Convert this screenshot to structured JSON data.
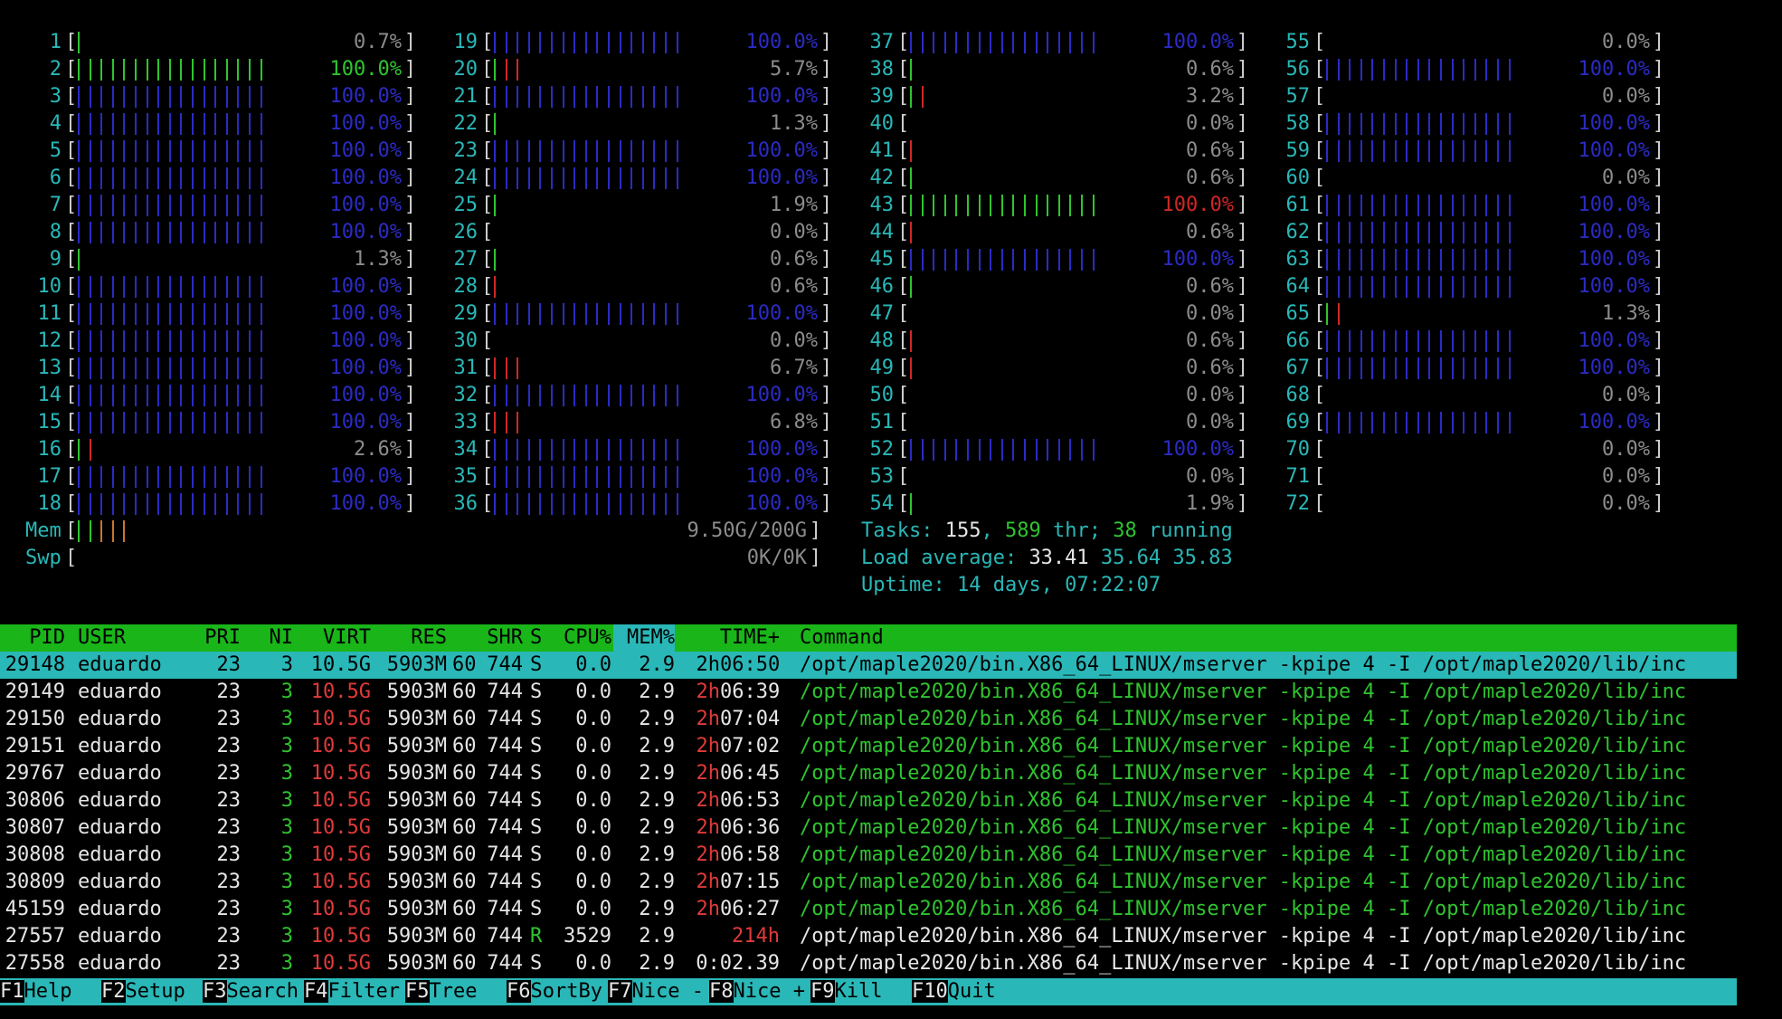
{
  "colors": {
    "background": "#000000",
    "cyan": "#2ab7b7",
    "blue_bar": "#2b2bc4",
    "green_bar": "#2fc42f",
    "red_bar": "#d02727",
    "header_bg": "#19b519"
  },
  "cpu_meters": [
    {
      "id": "1",
      "bars": [
        "g"
      ],
      "pct": "0.7%"
    },
    {
      "id": "2",
      "bars": [
        "g*17"
      ],
      "pct": "100.0%",
      "pct_color": "green"
    },
    {
      "id": "3",
      "bars": [
        "b*17"
      ],
      "pct": "100.0%"
    },
    {
      "id": "4",
      "bars": [
        "b*17"
      ],
      "pct": "100.0%"
    },
    {
      "id": "5",
      "bars": [
        "b*17"
      ],
      "pct": "100.0%"
    },
    {
      "id": "6",
      "bars": [
        "b*17"
      ],
      "pct": "100.0%"
    },
    {
      "id": "7",
      "bars": [
        "b*17"
      ],
      "pct": "100.0%"
    },
    {
      "id": "8",
      "bars": [
        "b*17"
      ],
      "pct": "100.0%"
    },
    {
      "id": "9",
      "bars": [
        "g"
      ],
      "pct": "1.3%"
    },
    {
      "id": "10",
      "bars": [
        "b*17"
      ],
      "pct": "100.0%"
    },
    {
      "id": "11",
      "bars": [
        "b*17"
      ],
      "pct": "100.0%"
    },
    {
      "id": "12",
      "bars": [
        "b*17"
      ],
      "pct": "100.0%"
    },
    {
      "id": "13",
      "bars": [
        "b*17"
      ],
      "pct": "100.0%"
    },
    {
      "id": "14",
      "bars": [
        "b*17"
      ],
      "pct": "100.0%"
    },
    {
      "id": "15",
      "bars": [
        "b*17"
      ],
      "pct": "100.0%"
    },
    {
      "id": "16",
      "bars": [
        "g",
        "r"
      ],
      "pct": "2.6%"
    },
    {
      "id": "17",
      "bars": [
        "b*17"
      ],
      "pct": "100.0%"
    },
    {
      "id": "18",
      "bars": [
        "b*17"
      ],
      "pct": "100.0%"
    },
    {
      "id": "19",
      "bars": [
        "b*17"
      ],
      "pct": "100.0%"
    },
    {
      "id": "20",
      "bars": [
        "g",
        "r",
        "r"
      ],
      "pct": "5.7%"
    },
    {
      "id": "21",
      "bars": [
        "b*17"
      ],
      "pct": "100.0%"
    },
    {
      "id": "22",
      "bars": [
        "g"
      ],
      "pct": "1.3%"
    },
    {
      "id": "23",
      "bars": [
        "b*17"
      ],
      "pct": "100.0%"
    },
    {
      "id": "24",
      "bars": [
        "b*17"
      ],
      "pct": "100.0%"
    },
    {
      "id": "25",
      "bars": [
        "g"
      ],
      "pct": "1.9%"
    },
    {
      "id": "26",
      "bars": [],
      "pct": "0.0%"
    },
    {
      "id": "27",
      "bars": [
        "g"
      ],
      "pct": "0.6%"
    },
    {
      "id": "28",
      "bars": [
        "r"
      ],
      "pct": "0.6%"
    },
    {
      "id": "29",
      "bars": [
        "b*17"
      ],
      "pct": "100.0%"
    },
    {
      "id": "30",
      "bars": [],
      "pct": "0.0%"
    },
    {
      "id": "31",
      "bars": [
        "r",
        "r",
        "r"
      ],
      "pct": "6.7%"
    },
    {
      "id": "32",
      "bars": [
        "b*17"
      ],
      "pct": "100.0%"
    },
    {
      "id": "33",
      "bars": [
        "r",
        "r",
        "r"
      ],
      "pct": "6.8%"
    },
    {
      "id": "34",
      "bars": [
        "b*17"
      ],
      "pct": "100.0%"
    },
    {
      "id": "35",
      "bars": [
        "b*17"
      ],
      "pct": "100.0%"
    },
    {
      "id": "36",
      "bars": [
        "b*17"
      ],
      "pct": "100.0%"
    },
    {
      "id": "37",
      "bars": [
        "b*17"
      ],
      "pct": "100.0%"
    },
    {
      "id": "38",
      "bars": [
        "g"
      ],
      "pct": "0.6%"
    },
    {
      "id": "39",
      "bars": [
        "g",
        "r"
      ],
      "pct": "3.2%"
    },
    {
      "id": "40",
      "bars": [],
      "pct": "0.0%"
    },
    {
      "id": "41",
      "bars": [
        "r"
      ],
      "pct": "0.6%"
    },
    {
      "id": "42",
      "bars": [
        "g"
      ],
      "pct": "0.6%"
    },
    {
      "id": "43",
      "bars": [
        "g*17"
      ],
      "pct": "100.0%",
      "pct_color": "red"
    },
    {
      "id": "44",
      "bars": [
        "r"
      ],
      "pct": "0.6%"
    },
    {
      "id": "45",
      "bars": [
        "b*17"
      ],
      "pct": "100.0%"
    },
    {
      "id": "46",
      "bars": [
        "g"
      ],
      "pct": "0.6%"
    },
    {
      "id": "47",
      "bars": [],
      "pct": "0.0%"
    },
    {
      "id": "48",
      "bars": [
        "r"
      ],
      "pct": "0.6%"
    },
    {
      "id": "49",
      "bars": [
        "r"
      ],
      "pct": "0.6%"
    },
    {
      "id": "50",
      "bars": [],
      "pct": "0.0%"
    },
    {
      "id": "51",
      "bars": [],
      "pct": "0.0%"
    },
    {
      "id": "52",
      "bars": [
        "b*17"
      ],
      "pct": "100.0%"
    },
    {
      "id": "53",
      "bars": [],
      "pct": "0.0%"
    },
    {
      "id": "54",
      "bars": [
        "g"
      ],
      "pct": "1.9%"
    },
    {
      "id": "55",
      "bars": [],
      "pct": "0.0%"
    },
    {
      "id": "56",
      "bars": [
        "b*17"
      ],
      "pct": "100.0%"
    },
    {
      "id": "57",
      "bars": [],
      "pct": "0.0%"
    },
    {
      "id": "58",
      "bars": [
        "b*17"
      ],
      "pct": "100.0%"
    },
    {
      "id": "59",
      "bars": [
        "b*17"
      ],
      "pct": "100.0%"
    },
    {
      "id": "60",
      "bars": [],
      "pct": "0.0%"
    },
    {
      "id": "61",
      "bars": [
        "b*17"
      ],
      "pct": "100.0%"
    },
    {
      "id": "62",
      "bars": [
        "b*17"
      ],
      "pct": "100.0%"
    },
    {
      "id": "63",
      "bars": [
        "b*17"
      ],
      "pct": "100.0%"
    },
    {
      "id": "64",
      "bars": [
        "b*17"
      ],
      "pct": "100.0%"
    },
    {
      "id": "65",
      "bars": [
        "g",
        "r"
      ],
      "pct": "1.3%"
    },
    {
      "id": "66",
      "bars": [
        "b*17"
      ],
      "pct": "100.0%"
    },
    {
      "id": "67",
      "bars": [
        "b*17"
      ],
      "pct": "100.0%"
    },
    {
      "id": "68",
      "bars": [],
      "pct": "0.0%"
    },
    {
      "id": "69",
      "bars": [
        "b*17"
      ],
      "pct": "100.0%"
    },
    {
      "id": "70",
      "bars": [],
      "pct": "0.0%"
    },
    {
      "id": "71",
      "bars": [],
      "pct": "0.0%"
    },
    {
      "id": "72",
      "bars": [],
      "pct": "0.0%"
    }
  ],
  "mem": {
    "label": "Mem",
    "bars": [
      "g",
      "g",
      "o",
      "o",
      "o"
    ],
    "value": "9.50G/200G"
  },
  "swp": {
    "label": "Swp",
    "value": "0K/0K"
  },
  "tasks": {
    "label": "Tasks:",
    "count": "155",
    "sep1": ",",
    "threads": "589",
    "thr": "thr;",
    "running": "38",
    "running_label": "running"
  },
  "load": {
    "label": "Load average:",
    "v1": "33.41",
    "v2": "35.64",
    "v3": "35.83"
  },
  "uptime": {
    "label": "Uptime:",
    "value": "14 days, 07:22:07"
  },
  "table_headers": {
    "pid": "PID",
    "user": "USER",
    "pri": "PRI",
    "ni": "NI",
    "virt": "VIRT",
    "res": "RES",
    "shr": "SHR",
    "s": "S",
    "cpu": "CPU%",
    "mem": "MEM%",
    "time": "TIME+",
    "cmd": "Command"
  },
  "processes": [
    {
      "pid": "29148",
      "user": "eduardo",
      "pri": "23",
      "ni": "3",
      "virt": "10.5G",
      "res": "5903M",
      "shr_hi": "60",
      "shr_lo": "744",
      "s": "S",
      "cpu": "0.0",
      "mem": "2.9",
      "time_h": "2h",
      "time_rest": "06:50",
      "cmd": "/opt/maple2020/bin.X86_64_LINUX/mserver -kpipe 4 -I /opt/maple2020/lib/inc"
    },
    {
      "pid": "29149",
      "user": "eduardo",
      "pri": "23",
      "ni": "3",
      "virt": "10.5G",
      "res": "5903M",
      "shr_hi": "60",
      "shr_lo": "744",
      "s": "S",
      "cpu": "0.0",
      "mem": "2.9",
      "time_h": "2h",
      "time_rest": "06:39",
      "cmd": "/opt/maple2020/bin.X86_64_LINUX/mserver -kpipe 4 -I /opt/maple2020/lib/inc"
    },
    {
      "pid": "29150",
      "user": "eduardo",
      "pri": "23",
      "ni": "3",
      "virt": "10.5G",
      "res": "5903M",
      "shr_hi": "60",
      "shr_lo": "744",
      "s": "S",
      "cpu": "0.0",
      "mem": "2.9",
      "time_h": "2h",
      "time_rest": "07:04",
      "cmd": "/opt/maple2020/bin.X86_64_LINUX/mserver -kpipe 4 -I /opt/maple2020/lib/inc"
    },
    {
      "pid": "29151",
      "user": "eduardo",
      "pri": "23",
      "ni": "3",
      "virt": "10.5G",
      "res": "5903M",
      "shr_hi": "60",
      "shr_lo": "744",
      "s": "S",
      "cpu": "0.0",
      "mem": "2.9",
      "time_h": "2h",
      "time_rest": "07:02",
      "cmd": "/opt/maple2020/bin.X86_64_LINUX/mserver -kpipe 4 -I /opt/maple2020/lib/inc"
    },
    {
      "pid": "29767",
      "user": "eduardo",
      "pri": "23",
      "ni": "3",
      "virt": "10.5G",
      "res": "5903M",
      "shr_hi": "60",
      "shr_lo": "744",
      "s": "S",
      "cpu": "0.0",
      "mem": "2.9",
      "time_h": "2h",
      "time_rest": "06:45",
      "cmd": "/opt/maple2020/bin.X86_64_LINUX/mserver -kpipe 4 -I /opt/maple2020/lib/inc"
    },
    {
      "pid": "30806",
      "user": "eduardo",
      "pri": "23",
      "ni": "3",
      "virt": "10.5G",
      "res": "5903M",
      "shr_hi": "60",
      "shr_lo": "744",
      "s": "S",
      "cpu": "0.0",
      "mem": "2.9",
      "time_h": "2h",
      "time_rest": "06:53",
      "cmd": "/opt/maple2020/bin.X86_64_LINUX/mserver -kpipe 4 -I /opt/maple2020/lib/inc"
    },
    {
      "pid": "30807",
      "user": "eduardo",
      "pri": "23",
      "ni": "3",
      "virt": "10.5G",
      "res": "5903M",
      "shr_hi": "60",
      "shr_lo": "744",
      "s": "S",
      "cpu": "0.0",
      "mem": "2.9",
      "time_h": "2h",
      "time_rest": "06:36",
      "cmd": "/opt/maple2020/bin.X86_64_LINUX/mserver -kpipe 4 -I /opt/maple2020/lib/inc"
    },
    {
      "pid": "30808",
      "user": "eduardo",
      "pri": "23",
      "ni": "3",
      "virt": "10.5G",
      "res": "5903M",
      "shr_hi": "60",
      "shr_lo": "744",
      "s": "S",
      "cpu": "0.0",
      "mem": "2.9",
      "time_h": "2h",
      "time_rest": "06:58",
      "cmd": "/opt/maple2020/bin.X86_64_LINUX/mserver -kpipe 4 -I /opt/maple2020/lib/inc"
    },
    {
      "pid": "30809",
      "user": "eduardo",
      "pri": "23",
      "ni": "3",
      "virt": "10.5G",
      "res": "5903M",
      "shr_hi": "60",
      "shr_lo": "744",
      "s": "S",
      "cpu": "0.0",
      "mem": "2.9",
      "time_h": "2h",
      "time_rest": "07:15",
      "cmd": "/opt/maple2020/bin.X86_64_LINUX/mserver -kpipe 4 -I /opt/maple2020/lib/inc"
    },
    {
      "pid": "45159",
      "user": "eduardo",
      "pri": "23",
      "ni": "3",
      "virt": "10.5G",
      "res": "5903M",
      "shr_hi": "60",
      "shr_lo": "744",
      "s": "S",
      "cpu": "0.0",
      "mem": "2.9",
      "time_h": "2h",
      "time_rest": "06:27",
      "cmd": "/opt/maple2020/bin.X86_64_LINUX/mserver -kpipe 4 -I /opt/maple2020/lib/inc"
    },
    {
      "pid": "27557",
      "user": "eduardo",
      "pri": "23",
      "ni": "3",
      "virt": "10.5G",
      "res": "5903M",
      "shr_hi": "60",
      "shr_lo": "744",
      "s": "R",
      "cpu": "3529",
      "mem": "2.9",
      "time_h": "214h",
      "time_rest": "",
      "cmd": "/opt/maple2020/bin.X86_64_LINUX/mserver -kpipe 4 -I /opt/maple2020/lib/inc"
    },
    {
      "pid": "27558",
      "user": "eduardo",
      "pri": "23",
      "ni": "3",
      "virt": "10.5G",
      "res": "5903M",
      "shr_hi": "60",
      "shr_lo": "744",
      "s": "S",
      "cpu": "0.0",
      "mem": "2.9",
      "time_h": "",
      "time_rest": "0:02.39",
      "cmd": "/opt/maple2020/bin.X86_64_LINUX/mserver -kpipe 4 -I /opt/maple2020/lib/inc"
    }
  ],
  "function_keys": [
    {
      "key": "F1",
      "label": "Help  "
    },
    {
      "key": "F2",
      "label": "Setup "
    },
    {
      "key": "F3",
      "label": "Search"
    },
    {
      "key": "F4",
      "label": "Filter"
    },
    {
      "key": "F5",
      "label": "Tree  "
    },
    {
      "key": "F6",
      "label": "SortBy"
    },
    {
      "key": "F7",
      "label": "Nice -"
    },
    {
      "key": "F8",
      "label": "Nice +"
    },
    {
      "key": "F9",
      "label": "Kill  "
    },
    {
      "key": "F10",
      "label": "Quit  "
    }
  ]
}
